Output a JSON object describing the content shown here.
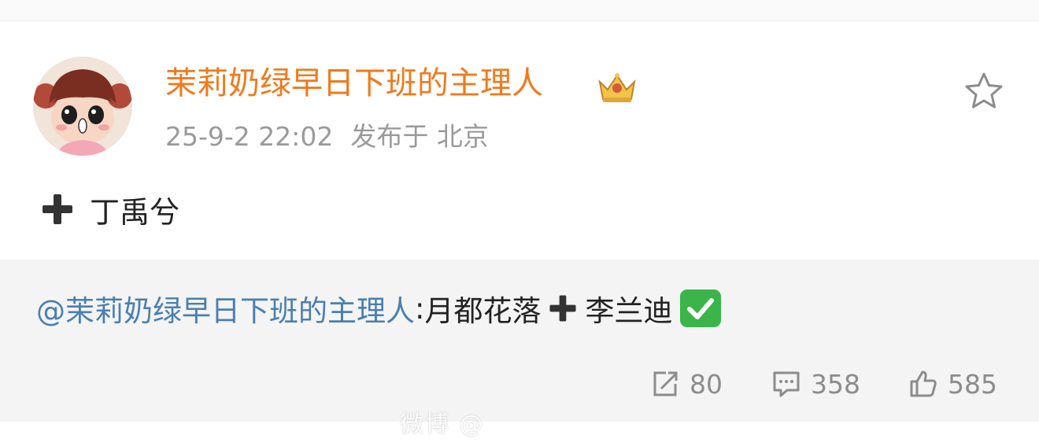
{
  "post": {
    "author": "茉莉奶绿早日下班的主理人",
    "timestamp": "25-9-2 22:02",
    "location": "发布于 北京",
    "text": "丁禹兮"
  },
  "repost": {
    "mention": "@茉莉奶绿早日下班的主理人",
    "colon": ":",
    "text_before": "月都花落",
    "text_after": "李兰迪"
  },
  "actions": {
    "share_count": "80",
    "comment_count": "358",
    "like_count": "585"
  },
  "watermark": "微博 @",
  "colors": {
    "author": "#f07a1c",
    "mention": "#4a7fb0",
    "check": "#3bb54a",
    "icon": "#8c8c8c"
  },
  "icons": [
    "heavy-plus-icon",
    "crown-badge-icon",
    "star-icon",
    "check-mark-button-icon",
    "share-icon",
    "comment-icon",
    "like-icon"
  ]
}
